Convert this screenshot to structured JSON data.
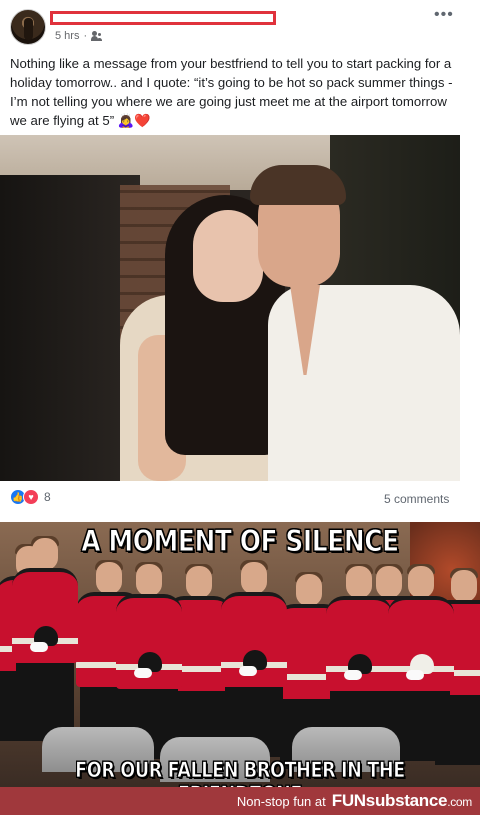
{
  "post": {
    "time": "5 hrs",
    "separator": "·",
    "text": "Nothing like a message from your bestfriend to tell you to start packing for a holiday tomorrow.. and I quote: “it’s going to be hot so pack summer things - I’m not telling you where we are going just meet me at the airport tomorrow we are flying at 5” 🙇‍♀️❤️",
    "more_menu": "•••",
    "reactions_count": "8",
    "comments": "5 comments",
    "reaction_icons": [
      "like-icon",
      "love-icon"
    ],
    "colors": {
      "redaction": "#e0323c",
      "like": "#1877f2",
      "love": "#f33e58"
    }
  },
  "meme": {
    "top_text": "A MOMENT OF SILENCE",
    "bottom_text": "FOR OUR FALLEN BROTHER IN THE FRIENDZONE",
    "colors": {
      "tunic": "#c8102e",
      "text": "#ffffff"
    }
  },
  "watermark": {
    "tagline": "Non-stop fun at",
    "logo_fun": "FUN",
    "logo_rest": "substance",
    "logo_tld": ".com",
    "color": "#a0383c"
  }
}
